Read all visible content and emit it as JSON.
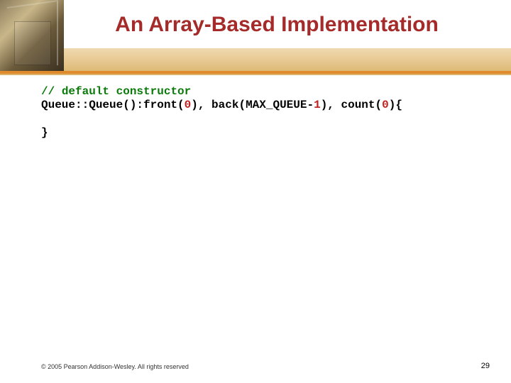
{
  "slide": {
    "title": "An Array-Based Implementation",
    "footer": "© 2005 Pearson Addison-Wesley. All rights reserved",
    "page_number": "29",
    "code": {
      "comment_prefix": "// ",
      "comment_text": "default constructor",
      "line2_a": "Queue::Queue():front(",
      "zero1": "0",
      "line2_b": "), back(MAX_QUEUE-",
      "one": "1",
      "line2_c": "), count(",
      "zero2": "0",
      "line2_d": "){",
      "close": "}"
    }
  }
}
